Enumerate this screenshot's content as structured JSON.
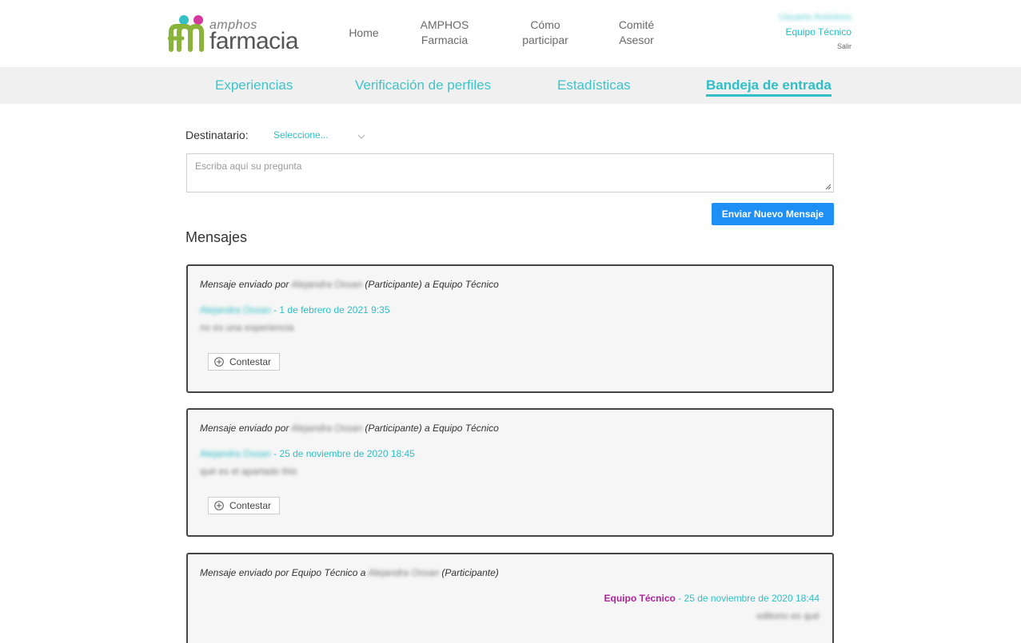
{
  "header": {
    "logo_small": "amphos",
    "logo_large": "farmacia",
    "nav": [
      {
        "label": "Home"
      },
      {
        "label": "AMPHOS Farmacia"
      },
      {
        "label": "Cómo participar"
      },
      {
        "label": "Comité Asesor"
      }
    ],
    "user": {
      "name": "Usuario Anónimo",
      "role": "Equipo Técnico",
      "logout": "Salir"
    }
  },
  "subnav": {
    "tabs": [
      {
        "label": "Experiencias"
      },
      {
        "label": "Verificación de perfiles"
      },
      {
        "label": "Estadísticas"
      },
      {
        "label": "Bandeja de entrada"
      }
    ]
  },
  "form": {
    "recipient_label": "Destinatario:",
    "recipient_value": "Seleccione...",
    "question_placeholder": "Escriba aquí su pregunta",
    "send_label": "Enviar Nuevo Mensaje"
  },
  "messages_title": "Mensajes",
  "messages": [
    {
      "prefix": "Mensaje enviado por",
      "sender": "Alejandra Ossan",
      "role": "(Participante) a Equipo Técnico",
      "author": "Alejandra Ossan",
      "date": "- 1 de febrero de 2021 9:35",
      "body": "no es una experiencia",
      "reply_label": "Contestar"
    },
    {
      "prefix": "Mensaje enviado por",
      "sender": "Alejandra Ossan",
      "role": "(Participante) a Equipo Técnico",
      "author": "Alejandra Ossan",
      "date": "- 25 de noviembre de 2020 18:45",
      "body": "qué es el apartado this",
      "reply_label": "Contestar"
    },
    {
      "prefix": "Mensaje enviado por Equipo Técnico a",
      "recipient": "Alejandra Ossan",
      "role": "(Participante)",
      "author": "Equipo Técnico",
      "date": "- 25 de noviembre de 2020 18:44",
      "body": "editorio es qué"
    }
  ]
}
